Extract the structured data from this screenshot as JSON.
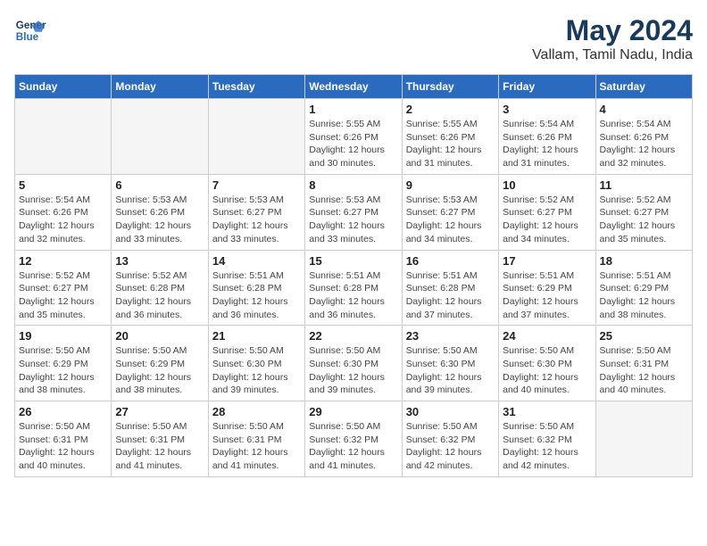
{
  "header": {
    "logo_line1": "General",
    "logo_line2": "Blue",
    "month_year": "May 2024",
    "location": "Vallam, Tamil Nadu, India"
  },
  "weekdays": [
    "Sunday",
    "Monday",
    "Tuesday",
    "Wednesday",
    "Thursday",
    "Friday",
    "Saturday"
  ],
  "weeks": [
    [
      {
        "day": "",
        "info": ""
      },
      {
        "day": "",
        "info": ""
      },
      {
        "day": "",
        "info": ""
      },
      {
        "day": "1",
        "info": "Sunrise: 5:55 AM\nSunset: 6:26 PM\nDaylight: 12 hours\nand 30 minutes."
      },
      {
        "day": "2",
        "info": "Sunrise: 5:55 AM\nSunset: 6:26 PM\nDaylight: 12 hours\nand 31 minutes."
      },
      {
        "day": "3",
        "info": "Sunrise: 5:54 AM\nSunset: 6:26 PM\nDaylight: 12 hours\nand 31 minutes."
      },
      {
        "day": "4",
        "info": "Sunrise: 5:54 AM\nSunset: 6:26 PM\nDaylight: 12 hours\nand 32 minutes."
      }
    ],
    [
      {
        "day": "5",
        "info": "Sunrise: 5:54 AM\nSunset: 6:26 PM\nDaylight: 12 hours\nand 32 minutes."
      },
      {
        "day": "6",
        "info": "Sunrise: 5:53 AM\nSunset: 6:26 PM\nDaylight: 12 hours\nand 33 minutes."
      },
      {
        "day": "7",
        "info": "Sunrise: 5:53 AM\nSunset: 6:27 PM\nDaylight: 12 hours\nand 33 minutes."
      },
      {
        "day": "8",
        "info": "Sunrise: 5:53 AM\nSunset: 6:27 PM\nDaylight: 12 hours\nand 33 minutes."
      },
      {
        "day": "9",
        "info": "Sunrise: 5:53 AM\nSunset: 6:27 PM\nDaylight: 12 hours\nand 34 minutes."
      },
      {
        "day": "10",
        "info": "Sunrise: 5:52 AM\nSunset: 6:27 PM\nDaylight: 12 hours\nand 34 minutes."
      },
      {
        "day": "11",
        "info": "Sunrise: 5:52 AM\nSunset: 6:27 PM\nDaylight: 12 hours\nand 35 minutes."
      }
    ],
    [
      {
        "day": "12",
        "info": "Sunrise: 5:52 AM\nSunset: 6:27 PM\nDaylight: 12 hours\nand 35 minutes."
      },
      {
        "day": "13",
        "info": "Sunrise: 5:52 AM\nSunset: 6:28 PM\nDaylight: 12 hours\nand 36 minutes."
      },
      {
        "day": "14",
        "info": "Sunrise: 5:51 AM\nSunset: 6:28 PM\nDaylight: 12 hours\nand 36 minutes."
      },
      {
        "day": "15",
        "info": "Sunrise: 5:51 AM\nSunset: 6:28 PM\nDaylight: 12 hours\nand 36 minutes."
      },
      {
        "day": "16",
        "info": "Sunrise: 5:51 AM\nSunset: 6:28 PM\nDaylight: 12 hours\nand 37 minutes."
      },
      {
        "day": "17",
        "info": "Sunrise: 5:51 AM\nSunset: 6:29 PM\nDaylight: 12 hours\nand 37 minutes."
      },
      {
        "day": "18",
        "info": "Sunrise: 5:51 AM\nSunset: 6:29 PM\nDaylight: 12 hours\nand 38 minutes."
      }
    ],
    [
      {
        "day": "19",
        "info": "Sunrise: 5:50 AM\nSunset: 6:29 PM\nDaylight: 12 hours\nand 38 minutes."
      },
      {
        "day": "20",
        "info": "Sunrise: 5:50 AM\nSunset: 6:29 PM\nDaylight: 12 hours\nand 38 minutes."
      },
      {
        "day": "21",
        "info": "Sunrise: 5:50 AM\nSunset: 6:30 PM\nDaylight: 12 hours\nand 39 minutes."
      },
      {
        "day": "22",
        "info": "Sunrise: 5:50 AM\nSunset: 6:30 PM\nDaylight: 12 hours\nand 39 minutes."
      },
      {
        "day": "23",
        "info": "Sunrise: 5:50 AM\nSunset: 6:30 PM\nDaylight: 12 hours\nand 39 minutes."
      },
      {
        "day": "24",
        "info": "Sunrise: 5:50 AM\nSunset: 6:30 PM\nDaylight: 12 hours\nand 40 minutes."
      },
      {
        "day": "25",
        "info": "Sunrise: 5:50 AM\nSunset: 6:31 PM\nDaylight: 12 hours\nand 40 minutes."
      }
    ],
    [
      {
        "day": "26",
        "info": "Sunrise: 5:50 AM\nSunset: 6:31 PM\nDaylight: 12 hours\nand 40 minutes."
      },
      {
        "day": "27",
        "info": "Sunrise: 5:50 AM\nSunset: 6:31 PM\nDaylight: 12 hours\nand 41 minutes."
      },
      {
        "day": "28",
        "info": "Sunrise: 5:50 AM\nSunset: 6:31 PM\nDaylight: 12 hours\nand 41 minutes."
      },
      {
        "day": "29",
        "info": "Sunrise: 5:50 AM\nSunset: 6:32 PM\nDaylight: 12 hours\nand 41 minutes."
      },
      {
        "day": "30",
        "info": "Sunrise: 5:50 AM\nSunset: 6:32 PM\nDaylight: 12 hours\nand 42 minutes."
      },
      {
        "day": "31",
        "info": "Sunrise: 5:50 AM\nSunset: 6:32 PM\nDaylight: 12 hours\nand 42 minutes."
      },
      {
        "day": "",
        "info": ""
      }
    ]
  ]
}
